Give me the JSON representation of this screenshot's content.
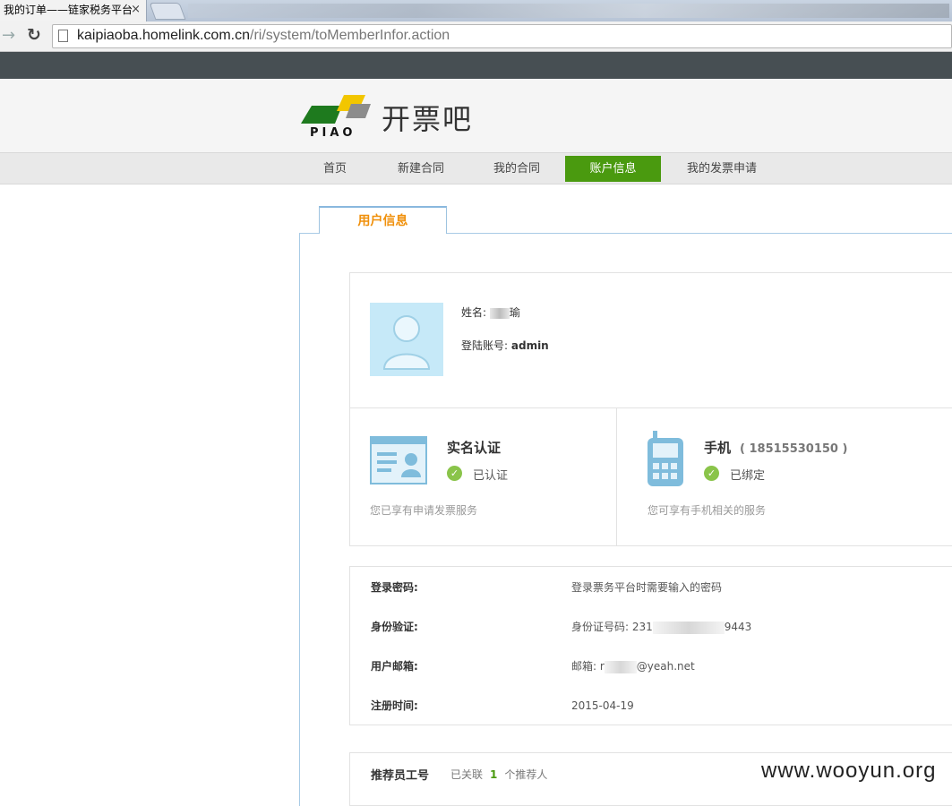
{
  "browser": {
    "tab_title": "我的订单——链家税务平台",
    "tab_close": "×",
    "url_host": "kaipiaoba.homelink.com.cn",
    "url_path": "/ri/system/toMemberInfor.action"
  },
  "site": {
    "logo_wordmark": "PIAO",
    "logo_text": "开票吧",
    "logo_colors": [
      "#1e7a1e",
      "#f2c600",
      "#8c8c8c"
    ]
  },
  "nav": {
    "items": [
      {
        "label": "首页"
      },
      {
        "label": "新建合同"
      },
      {
        "label": "我的合同"
      },
      {
        "label": "账户信息",
        "active": true
      },
      {
        "label": "我的发票申请"
      }
    ],
    "active_color": "#4a9a0f"
  },
  "content": {
    "tab_label": "用户信息",
    "profile": {
      "name_label": "姓名:",
      "name_value": "瑜",
      "account_label": "登陆账号:",
      "account_value": "admin"
    },
    "realname": {
      "title": "实名认证",
      "status": "已认证",
      "hint": "您已享有申请发票服务"
    },
    "phone": {
      "title": "手机",
      "number": "( 18515530150 )",
      "status": "已绑定",
      "hint": "您可享有手机相关的服务"
    },
    "info": [
      {
        "label": "登录密码:",
        "value": "登录票务平台时需要输入的密码"
      },
      {
        "label": "身份验证:",
        "value_prefix": "身份证号码: 231",
        "value_suffix": "9443"
      },
      {
        "label": "用户邮箱:",
        "value_prefix": "邮箱: r",
        "value_suffix": "@yeah.net"
      },
      {
        "label": "注册时间:",
        "value": "2015-04-19"
      }
    ],
    "referrer": {
      "label": "推荐员工号",
      "text_prefix": "已关联",
      "count": "1",
      "text_suffix": "个推荐人"
    }
  },
  "watermark": "www.wooyun.org"
}
